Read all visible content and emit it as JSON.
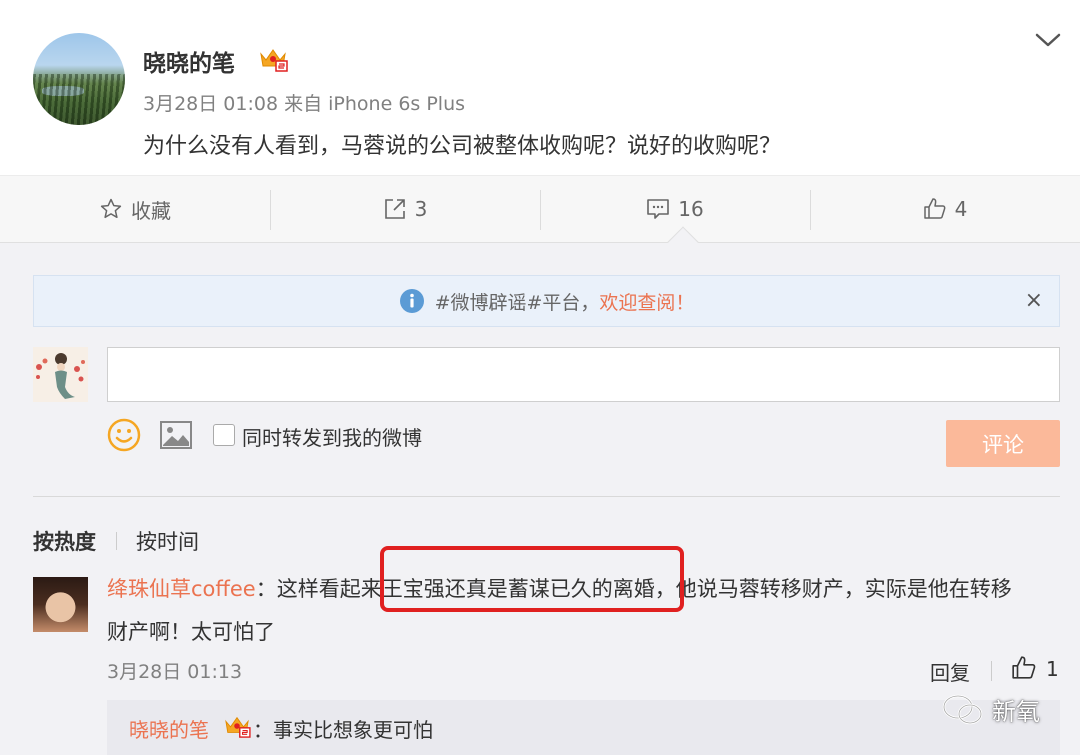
{
  "post": {
    "username": "晓晓的笔",
    "meta": "3月28日 01:08 来自 iPhone 6s Plus",
    "text": "为什么没有人看到，马蓉说的公司被整体收购呢？说好的收购呢？"
  },
  "actions": {
    "favorite": "收藏",
    "repost_count": "3",
    "comment_count": "16",
    "like_count": "4"
  },
  "notice": {
    "text": "#微博辟谣#平台，",
    "link": "欢迎查阅！",
    "close": "×"
  },
  "composer": {
    "repost_label": "同时转发到我的微博",
    "submit_label": "评论"
  },
  "sort": {
    "hot": "按热度",
    "time": "按时间"
  },
  "comment": {
    "author": "绛珠仙草coffee",
    "line1": "：这样看起来王宝强还真是蓄谋已久的离婚，他说马蓉转移财产，实际是他在转移",
    "line2": "财产啊！太可怕了",
    "time": "3月28日 01:13",
    "reply": "回复",
    "likes": "1"
  },
  "sub_reply": {
    "author": "晓晓的笔",
    "text": "：事实比想象更可怕"
  },
  "watermark": {
    "label": "新氧"
  },
  "colors": {
    "accent": "#eb7350",
    "submit_bg": "#fbb99a",
    "highlight": "#e02020",
    "notice_bg": "#eaf1fa"
  }
}
